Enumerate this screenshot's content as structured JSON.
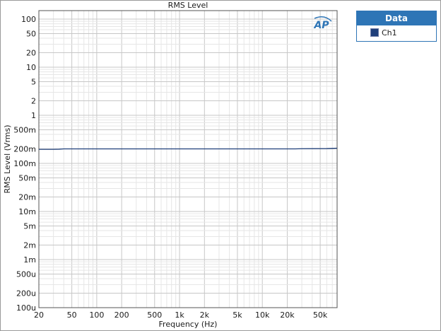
{
  "colors": {
    "series": "#1f3f7a",
    "grid_major": "#c7c7c7",
    "grid_minor": "#e6e6e6",
    "legend_accent": "#2e75b6",
    "ap_logo": "#2e75b6"
  },
  "logo": {
    "text": "AP"
  },
  "legend": {
    "header": "Data"
  },
  "chart_data": {
    "type": "line",
    "title": "RMS Level",
    "xlabel": "Frequency (Hz)",
    "ylabel": "RMS Level (Vrms)",
    "xscale": "log",
    "yscale": "log",
    "xlim": [
      20,
      80000
    ],
    "ylim": [
      0.0001,
      150
    ],
    "grid": true,
    "legend_position": "right-outside",
    "x_ticks": [
      {
        "v": 20,
        "label": "20"
      },
      {
        "v": 50,
        "label": "50"
      },
      {
        "v": 100,
        "label": "100"
      },
      {
        "v": 200,
        "label": "200"
      },
      {
        "v": 500,
        "label": "500"
      },
      {
        "v": 1000,
        "label": "1k"
      },
      {
        "v": 2000,
        "label": "2k"
      },
      {
        "v": 5000,
        "label": "5k"
      },
      {
        "v": 10000,
        "label": "10k"
      },
      {
        "v": 20000,
        "label": "20k"
      },
      {
        "v": 50000,
        "label": "50k"
      }
    ],
    "y_ticks": [
      {
        "v": 100,
        "label": "100"
      },
      {
        "v": 50,
        "label": "50"
      },
      {
        "v": 20,
        "label": "20"
      },
      {
        "v": 10,
        "label": "10"
      },
      {
        "v": 5,
        "label": "5"
      },
      {
        "v": 2,
        "label": "2"
      },
      {
        "v": 1,
        "label": "1"
      },
      {
        "v": 0.5,
        "label": "500m"
      },
      {
        "v": 0.2,
        "label": "200m"
      },
      {
        "v": 0.1,
        "label": "100m"
      },
      {
        "v": 0.05,
        "label": "50m"
      },
      {
        "v": 0.02,
        "label": "20m"
      },
      {
        "v": 0.01,
        "label": "10m"
      },
      {
        "v": 0.005,
        "label": "5m"
      },
      {
        "v": 0.002,
        "label": "2m"
      },
      {
        "v": 0.001,
        "label": "1m"
      },
      {
        "v": 0.0005,
        "label": "500u"
      },
      {
        "v": 0.0002,
        "label": "200u"
      },
      {
        "v": 0.0001,
        "label": "100u"
      }
    ],
    "series": [
      {
        "name": "Ch1",
        "color": "#1f3f7a",
        "x": [
          20,
          30,
          35,
          40,
          100,
          1000,
          10000,
          25000,
          30000,
          60000,
          70000,
          80000
        ],
        "y": [
          0.196,
          0.196,
          0.197,
          0.2,
          0.2,
          0.2,
          0.2,
          0.2,
          0.202,
          0.203,
          0.205,
          0.207
        ]
      }
    ]
  }
}
